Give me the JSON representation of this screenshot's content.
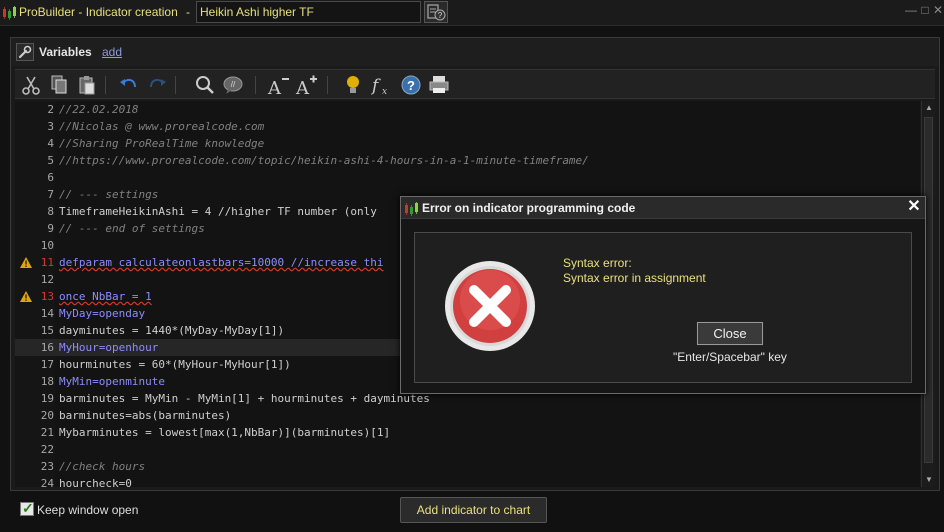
{
  "window": {
    "title": "ProBuilder - Indicator creation",
    "separator": "-",
    "indicator_name": "Heikin Ashi higher TF",
    "controls": [
      "minimize-icon",
      "maximize-icon",
      "close-icon"
    ]
  },
  "variables": {
    "label": "Variables",
    "add_link": "add"
  },
  "toolbar": {
    "icons": [
      "cut-icon",
      "copy-icon",
      "paste-icon",
      "undo-icon",
      "redo-icon",
      "search-icon",
      "comment-icon",
      "font-decrease-icon",
      "font-increase-icon",
      "lightbulb-icon",
      "function-icon",
      "help-icon",
      "print-icon"
    ]
  },
  "editor": {
    "lines": [
      {
        "n": "2",
        "text": "//22.02.2018"
      },
      {
        "n": "3",
        "text": "//Nicolas @ www.prorealcode.com"
      },
      {
        "n": "4",
        "text": "//Sharing ProRealTime knowledge"
      },
      {
        "n": "5",
        "text": "//https://www.prorealcode.com/topic/heikin-ashi-4-hours-in-a-1-minute-timeframe/"
      },
      {
        "n": "6",
        "text": ""
      },
      {
        "n": "7",
        "text": "// --- settings"
      },
      {
        "n": "8",
        "text": "TimeframeHeikinAshi = 4 //higher TF number (only"
      },
      {
        "n": "9",
        "text": "// --- end of settings"
      },
      {
        "n": "10",
        "text": ""
      },
      {
        "n": "11",
        "text": "defparam calculateonlastbars=10000 //increase thi"
      },
      {
        "n": "12",
        "text": ""
      },
      {
        "n": "13",
        "text": "once NbBar = 1"
      },
      {
        "n": "14",
        "text": "MyDay=openday"
      },
      {
        "n": "15",
        "text": "dayminutes = 1440*(MyDay-MyDay[1])"
      },
      {
        "n": "16",
        "text": "MyHour=openhour"
      },
      {
        "n": "17",
        "text": "hourminutes = 60*(MyHour-MyHour[1])"
      },
      {
        "n": "18",
        "text": "MyMin=openminute"
      },
      {
        "n": "19",
        "text": "barminutes = MyMin - MyMin[1] + hourminutes + dayminutes"
      },
      {
        "n": "20",
        "text": "barminutes=abs(barminutes)"
      },
      {
        "n": "21",
        "text": "Mybarminutes = lowest[max(1,NbBar)](barminutes)[1]"
      },
      {
        "n": "22",
        "text": ""
      },
      {
        "n": "23",
        "text": "//check hours"
      },
      {
        "n": "24",
        "text": "hourcheck=0"
      }
    ],
    "error_lines": [
      "11",
      "13"
    ],
    "highlighted_line": "16"
  },
  "bottom": {
    "keep_open_label": "Keep window open",
    "keep_open_checked": true,
    "add_button": "Add indicator to chart"
  },
  "dialog": {
    "title": "Error on indicator programming code",
    "message_line1": "Syntax error:",
    "message_line2": "Syntax error in assignment",
    "close_button": "Close",
    "close_hint": "\"Enter/Spacebar\" key"
  },
  "colors": {
    "accent_text": "#e8e07a",
    "error": "#d53b2b",
    "link": "#8f9bd6"
  }
}
